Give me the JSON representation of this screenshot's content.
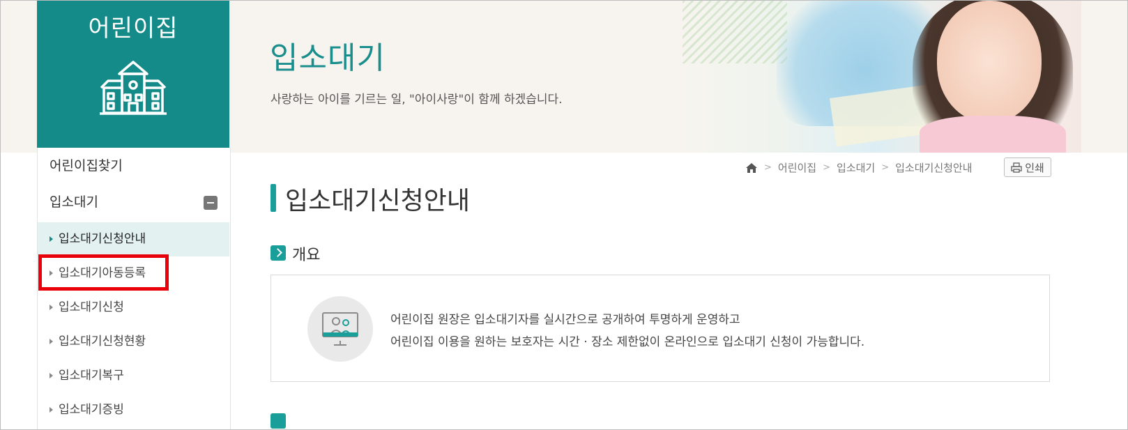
{
  "sidebar": {
    "title": "어린이집",
    "logo_icon": "school-building-icon",
    "nav_top": [
      {
        "label": "어린이집찾기"
      },
      {
        "label": "입소대기",
        "toggle_icon": "minus-icon"
      }
    ],
    "sub_items": [
      {
        "label": "입소대기신청안내",
        "active": true
      },
      {
        "label": "입소대기아동등록",
        "highlighted": true
      },
      {
        "label": "입소대기신청"
      },
      {
        "label": "입소대기신청현황"
      },
      {
        "label": "입소대기복구"
      },
      {
        "label": "입소대기증빙"
      }
    ]
  },
  "header": {
    "title": "입소대기",
    "subtitle": "사랑하는 아이를 기르는 일, \"아이사랑\"이 함께 하겠습니다."
  },
  "breadcrumb": {
    "home_icon": "home-icon",
    "items": [
      "어린이집",
      "입소대기",
      "입소대기신청안내"
    ],
    "separator": ">"
  },
  "print_button": {
    "label": "인쇄",
    "icon": "printer-icon"
  },
  "content": {
    "title": "입소대기신청안내",
    "section": {
      "title": "개요",
      "icon": "chevron-right-icon",
      "box_icon": "monitor-people-icon",
      "lines": [
        "어린이집 원장은 입소대기자를 실시간으로 공개하여 투명하게 운영하고",
        "어린이집 이용을 원하는 보호자는 시간 · 장소 제한없이 온라인으로 입소대기 신청이 가능합니다."
      ]
    }
  },
  "colors": {
    "accent": "#148a89",
    "highlight_border": "#e8000b",
    "active_bg": "#e3f2f1"
  }
}
